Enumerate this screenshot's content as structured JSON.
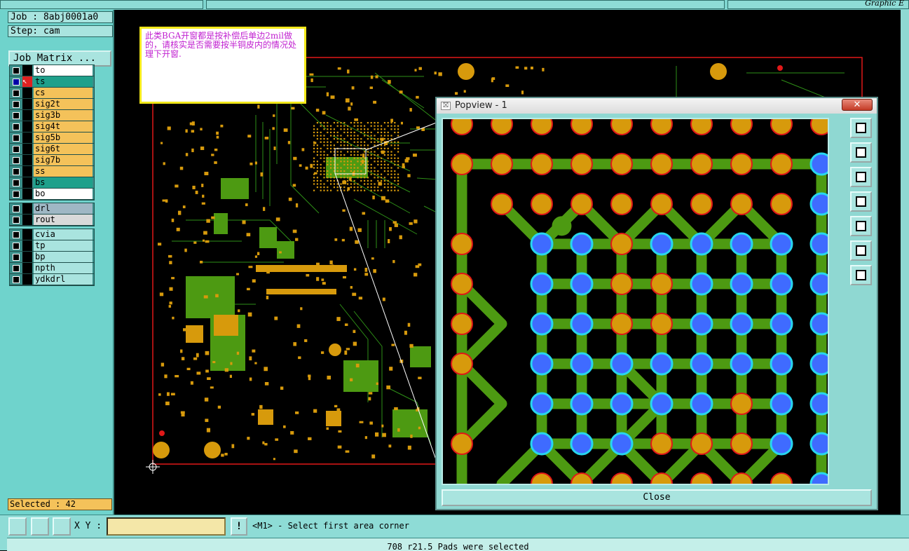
{
  "header": {
    "job": "Job : 8abj0001a0",
    "step": "Step: cam",
    "app_title": "Graphic E"
  },
  "left_panel": {
    "job_matrix_label": "Job Matrix ...",
    "board_layers": [
      {
        "name": "to",
        "color": "#ffffff",
        "tag": "✎"
      },
      {
        "name": "ts",
        "color": "#1fa08b",
        "tag": "▣",
        "active": true
      },
      {
        "name": "cs",
        "color": "#f4c25a",
        "tag": ""
      },
      {
        "name": "sig2t",
        "color": "#f4c25a",
        "tag": ""
      },
      {
        "name": "sig3b",
        "color": "#f4c25a",
        "tag": ""
      },
      {
        "name": "sig4t",
        "color": "#f4c25a",
        "tag": ""
      },
      {
        "name": "sig5b",
        "color": "#f4c25a",
        "tag": ""
      },
      {
        "name": "sig6t",
        "color": "#f4c25a",
        "tag": ""
      },
      {
        "name": "sig7b",
        "color": "#f4c25a",
        "tag": ""
      },
      {
        "name": "ss",
        "color": "#f4c25a",
        "tag": ""
      },
      {
        "name": "bs",
        "color": "#1fa08b",
        "tag": ""
      },
      {
        "name": "bo",
        "color": "#ffffff",
        "tag": "✎"
      }
    ],
    "drill_layers": [
      {
        "name": "drl",
        "color": "#9fb7c4"
      },
      {
        "name": "rout",
        "color": "#d9d9d9"
      }
    ],
    "misc_layers": [
      {
        "name": "cvia",
        "color": "#a9e4df"
      },
      {
        "name": "tp",
        "color": "#a9e4df"
      },
      {
        "name": "bp",
        "color": "#a9e4df"
      },
      {
        "name": "npth",
        "color": "#a9e4df"
      },
      {
        "name": "ydkdrl",
        "color": "#a9e4df"
      }
    ],
    "selected_count": "Selected : 42"
  },
  "note": {
    "text": "此类BGA开窗都是按补偿后单边2mil做的，请核实是否需要按半铜皮内的情况处理下开窗."
  },
  "popup": {
    "title": "Popview - 1",
    "close_x": "✕",
    "close_label": "Close",
    "tools": [
      "zoom-window-icon",
      "pan-up-icon",
      "pan-down-icon",
      "pan-left-icon",
      "pan-right-icon",
      "zoom-fit-icon",
      "zoom-home-icon"
    ]
  },
  "bottom": {
    "xy_label": "X Y :",
    "xy_value": "",
    "bang": "!",
    "status": "<M1> - Select first area corner",
    "message": "708 r21.5 Pads were selected"
  },
  "colors": {
    "pad_orange": "#d79a0c",
    "pad_blue": "#3f6bff",
    "trace_green": "#4d9a12",
    "pad_ring": "#e01818",
    "cyan_ring": "#27d6f0"
  }
}
